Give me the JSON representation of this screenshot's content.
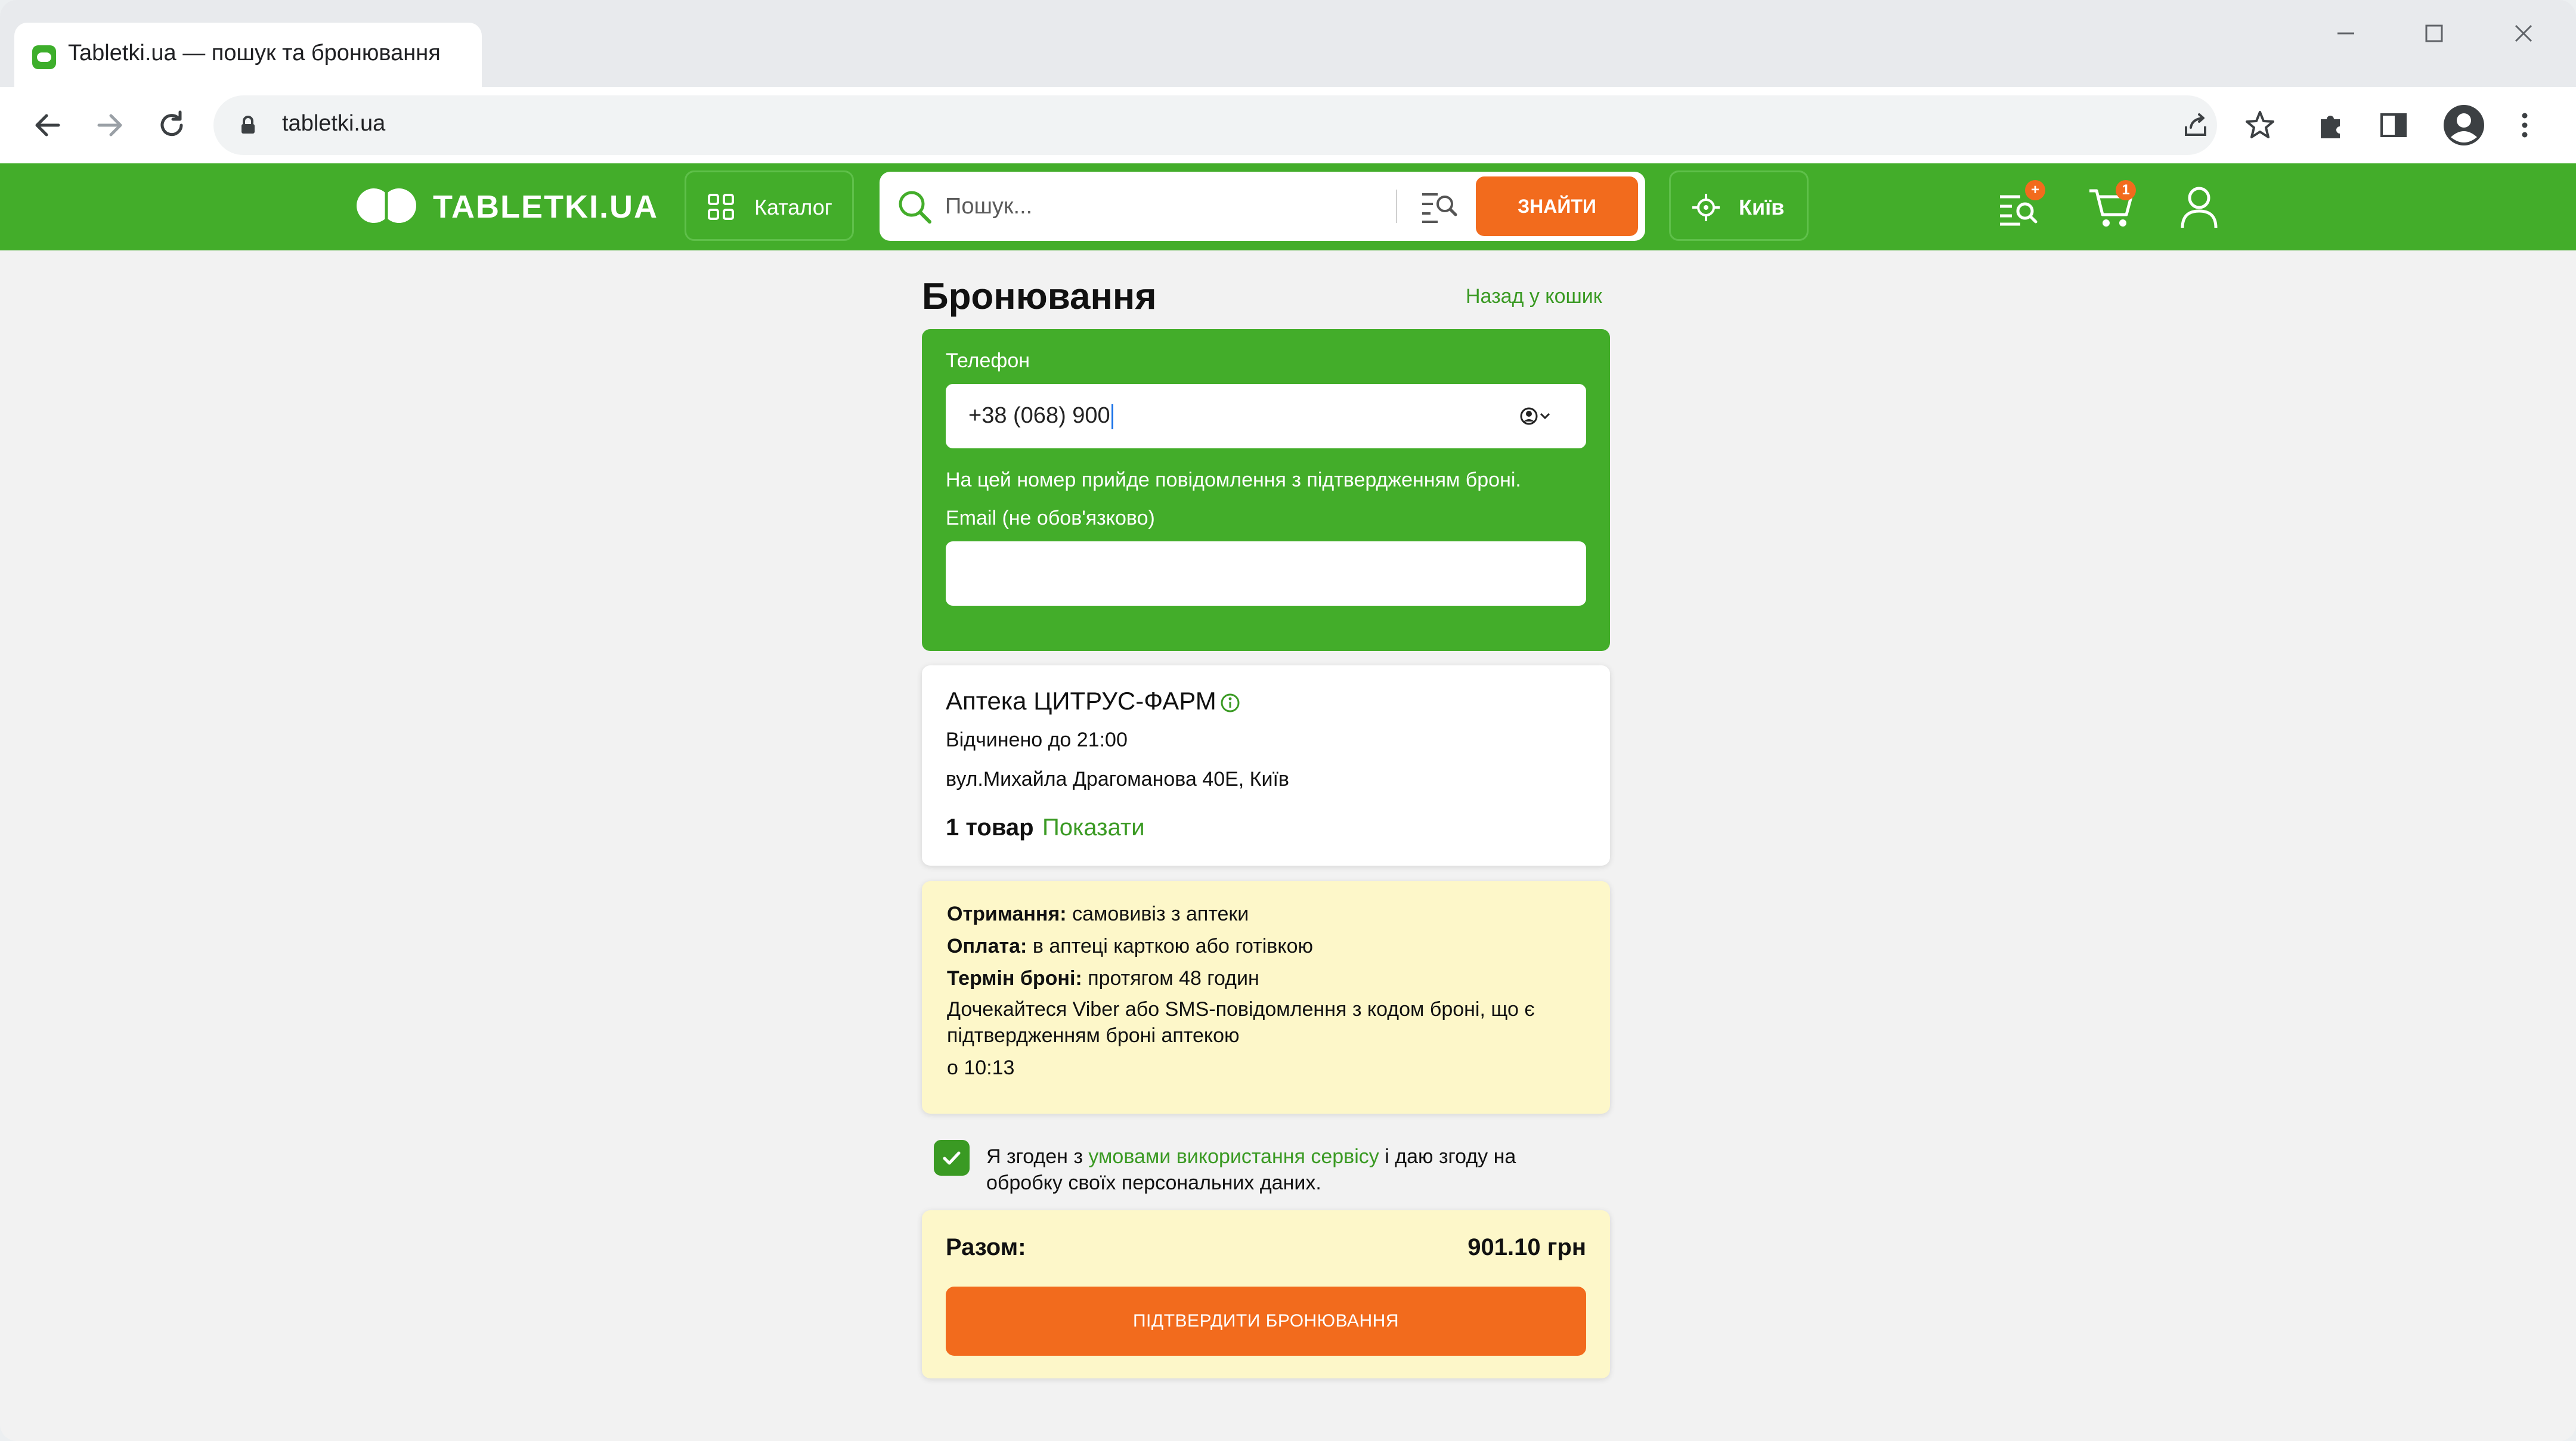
{
  "browser": {
    "tab_title": "Tabletki.ua — пошук та бронювання",
    "url": "tabletki.ua"
  },
  "header": {
    "logo_text": "TABLETKI.UA",
    "catalog_label": "Каталог",
    "search_placeholder": "Пошук...",
    "search_button": "ЗНАЙТИ",
    "city": "Київ",
    "cart_count": "1",
    "requests_badge": "+"
  },
  "page": {
    "title": "Бронювання",
    "back_link": "Назад у кошик"
  },
  "contact_form": {
    "phone_label": "Телефон",
    "phone_value": "+38 (068) 900",
    "phone_hint": "На цей номер прийде повідомлення з підтвердженням броні.",
    "email_label": "Email (не обов'язково)",
    "email_value": ""
  },
  "pharmacy": {
    "name": "Аптека ЦИТРУС-ФАРМ",
    "hours": "Відчинено до 21:00",
    "address": "вул.Михайла Драгоманова 40Е, Київ",
    "items_count": "1 товар",
    "show_link": "Показати"
  },
  "booking_terms": {
    "pickup_label": "Отримання:",
    "pickup_value": "самовивіз з аптеки",
    "payment_label": "Оплата:",
    "payment_value": "в аптеці карткою або готівкою",
    "term_label": "Термін броні:",
    "term_value": "протягом 48 годин",
    "note_line1": "Дочекайтеся Viber або SMS-повідомлення з кодом броні, що є",
    "note_line2": "підтвердженням броні аптекою",
    "time": "о 10:13"
  },
  "agreement": {
    "checked": true,
    "text_before": "Я згоден з ",
    "link_text": "умовами використання сервісу",
    "text_after": " і даю згоду на обробку своїх персональних даних."
  },
  "total": {
    "label": "Разом:",
    "amount": "901.10 грн",
    "confirm_button": "ПІДТВЕРДИТИ БРОНЮВАННЯ"
  }
}
